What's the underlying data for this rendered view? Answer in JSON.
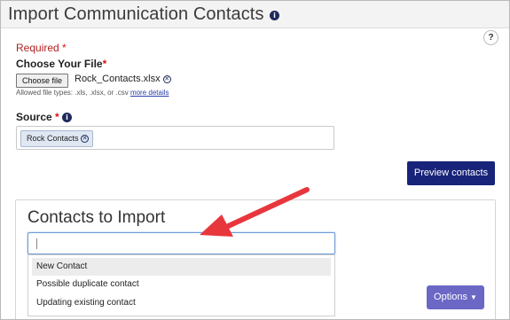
{
  "header": {
    "title": "Import Communication Contacts",
    "info_icon": "info-icon"
  },
  "help": {
    "label": "?"
  },
  "form": {
    "required_label": "Required",
    "required_star": "*",
    "file_label": "Choose Your File",
    "file_star": "*",
    "choose_file_label": "Choose file",
    "file_name": "Rock_Contacts.xlsx",
    "allowed_hint": "Allowed file types: .xls, .xlsx, or .csv",
    "more_details": "more details",
    "source_label": "Source",
    "source_star": "*",
    "source_chip": "Rock Contacts",
    "preview_button": "Preview contacts"
  },
  "import_panel": {
    "title": "Contacts to Import",
    "search_value": "",
    "dropdown_options": [
      "New Contact",
      "Possible duplicate contact",
      "Updating existing contact"
    ],
    "active_option": "New Contact",
    "options_button": "Options"
  },
  "colors": {
    "accent": "#18237a",
    "options": "#6b67c4",
    "required": "#b21f1f",
    "annotation_arrow": "#e8363d"
  }
}
